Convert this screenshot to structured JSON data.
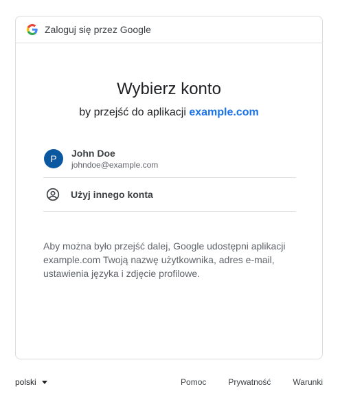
{
  "header": {
    "title": "Zaloguj się przez Google",
    "logo_icon": "google-g-icon"
  },
  "main": {
    "title": "Wybierz konto",
    "subtitle_prefix": "by przejść do aplikacji",
    "app_name": "example.com"
  },
  "accounts": [
    {
      "initial": "P",
      "name": "John Doe",
      "email": "johndoe@example.com",
      "avatar_color": "#0b57a0"
    }
  ],
  "other_account": {
    "label": "Użyj innego konta",
    "icon": "account-circle-icon"
  },
  "info": "Aby można było przejść dalej, Google udostępni aplikacji example.com Twoją nazwę użytkownika, adres e-mail, ustawienia języka i zdjęcie profilowe.",
  "footer": {
    "language": "polski",
    "links": [
      "Pomoc",
      "Prywatność",
      "Warunki"
    ]
  },
  "colors": {
    "accent": "#1a73e8",
    "border": "#dadce0",
    "muted_text": "#5f6368"
  }
}
